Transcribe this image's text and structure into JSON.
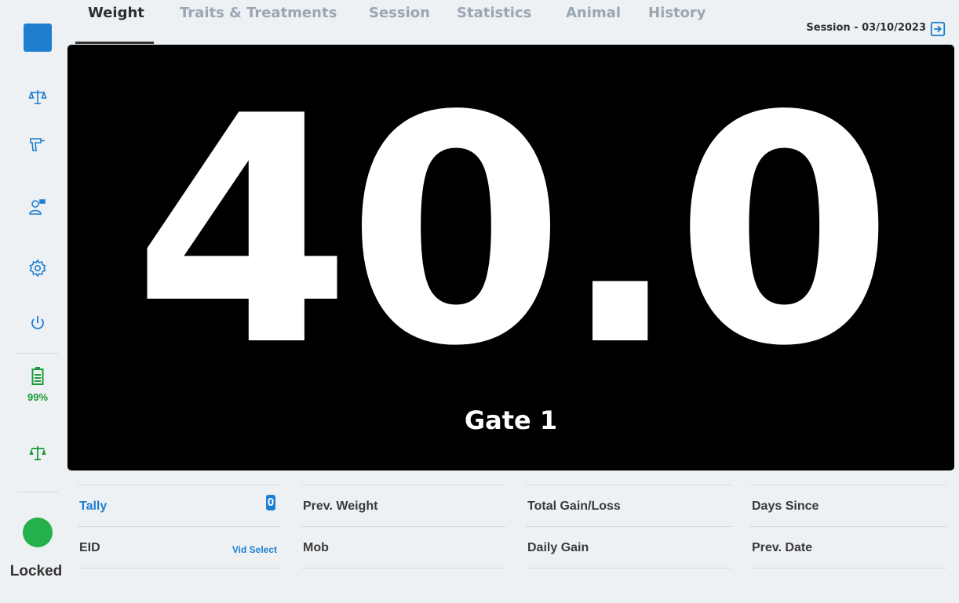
{
  "sidebar": {
    "icons": [
      "scale-icon",
      "gun-icon",
      "user-flag-icon",
      "gear-icon",
      "power-icon"
    ],
    "battery_icon": "battery-icon",
    "battery_percent": "99%",
    "scale_status_icon": "scale-status-icon",
    "status_color": "#24b04a",
    "locked_label": "Locked"
  },
  "tabs": [
    {
      "label": "Weight",
      "active": true
    },
    {
      "label": "Traits & Treatments",
      "active": false
    },
    {
      "label": "Session",
      "active": false
    },
    {
      "label": "Statistics",
      "active": false
    },
    {
      "label": "Animal",
      "active": false
    },
    {
      "label": "History",
      "active": false
    }
  ],
  "session": {
    "label": "Session - 03/10/2023",
    "exit_icon": "exit-icon"
  },
  "display": {
    "weight": "40.0",
    "gate": "Gate 1"
  },
  "info": {
    "tally_label": "Tally",
    "tally_value": "0",
    "eid_label": "EID",
    "vid_select": "Vid Select",
    "prev_weight_label": "Prev. Weight",
    "mob_label": "Mob",
    "total_gain_label": "Total Gain/Loss",
    "daily_gain_label": "Daily Gain",
    "days_since_label": "Days Since",
    "prev_date_label": "Prev. Date"
  },
  "colors": {
    "accent": "#1e7fd0",
    "battery_green": "#1c9a3a",
    "display_bg": "#000000"
  }
}
